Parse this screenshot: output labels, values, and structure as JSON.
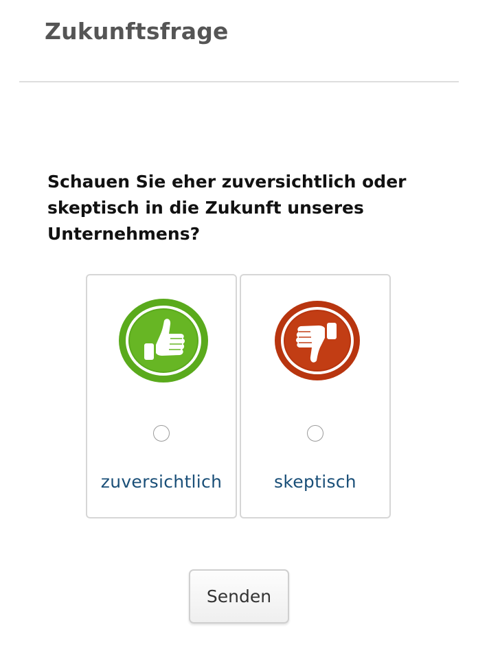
{
  "survey": {
    "title": "Zukunftsfrage",
    "question": "Schauen Sie eher zuversichtlich oder skeptisch in die Zukunft unseres Unternehmens?",
    "options": [
      {
        "label": "zuversichtlich",
        "icon": "thumbs-up-icon",
        "color": "#5aaa1c",
        "selected": false
      },
      {
        "label": "skeptisch",
        "icon": "thumbs-down-icon",
        "color": "#b8350f",
        "selected": false
      }
    ],
    "submit_label": "Senden"
  },
  "colors": {
    "title": "#555555",
    "question": "#111111",
    "option_label": "#1a4f78",
    "divider": "#dddddd",
    "card_border": "#d6d6d6"
  }
}
